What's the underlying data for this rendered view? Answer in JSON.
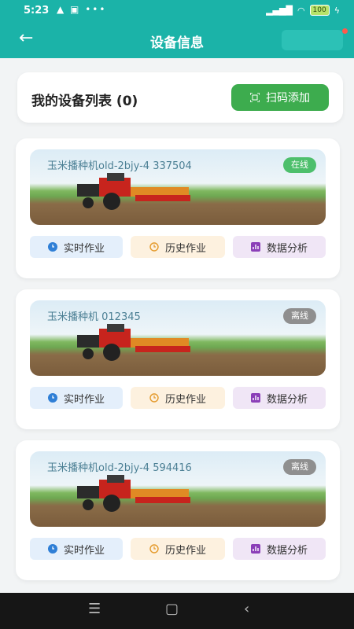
{
  "status_bar": {
    "time": "5:23",
    "notification_icons": "▲ ▣ •••",
    "battery": "100"
  },
  "app_bar": {
    "title": "设备信息"
  },
  "header": {
    "title": "我的设备列表 (0)",
    "scan_button": "扫码添加"
  },
  "devices": [
    {
      "name": "玉米播种机old-2bjy-4 337504",
      "status": "在线",
      "online": true
    },
    {
      "name": "玉米播种机 012345",
      "status": "离线",
      "online": false
    },
    {
      "name": "玉米播种机old-2bjy-4 594416",
      "status": "离线",
      "online": false
    }
  ],
  "actions": {
    "realtime": "实时作业",
    "history": "历史作业",
    "analysis": "数据分析"
  },
  "colors": {
    "primary": "#1bb3a8",
    "scan_green": "#3dac4e",
    "online": "#4dbf6c",
    "offline": "#8f8f8f"
  },
  "icons": {
    "back": "arrow-left-icon",
    "scan": "qr-scan-icon",
    "realtime": "clock-icon",
    "history": "history-icon",
    "analysis": "chart-icon"
  }
}
